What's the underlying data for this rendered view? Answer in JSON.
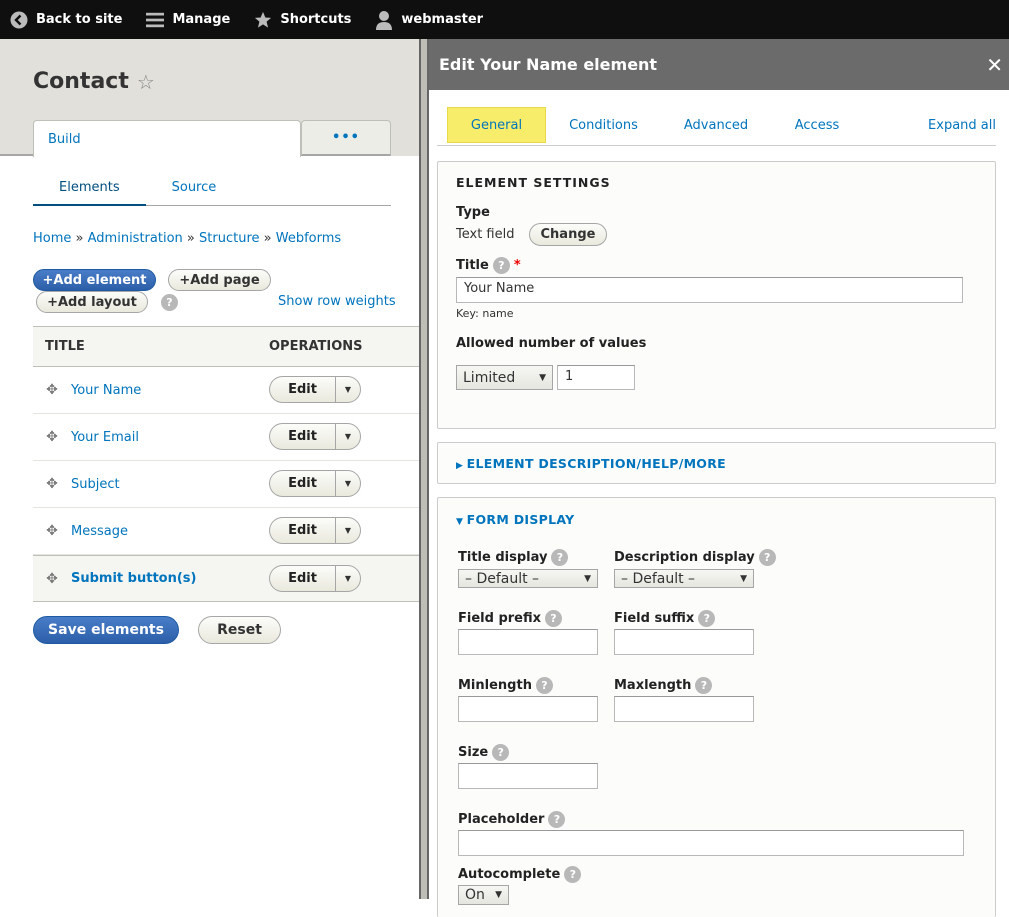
{
  "toolbar": {
    "back_to_site": "Back to site",
    "manage": "Manage",
    "shortcuts": "Shortcuts",
    "user": "webmaster"
  },
  "page": {
    "title": "Contact",
    "primary_tabs": [
      {
        "label": "Build",
        "active": true
      },
      {
        "label": "•••",
        "active": false
      }
    ],
    "secondary_tabs": [
      {
        "label": "Elements",
        "active": true
      },
      {
        "label": "Source",
        "active": false
      }
    ],
    "breadcrumb": [
      {
        "label": "Home"
      },
      {
        "label": "Administration"
      },
      {
        "label": "Structure"
      },
      {
        "label": "Webforms"
      }
    ],
    "breadcrumb_separator": "»",
    "actions": {
      "add_element": "+Add element",
      "add_page": "+Add page",
      "add_layout": "+Add layout",
      "show_row_weights": "Show row weights"
    },
    "table": {
      "headers": {
        "title": "TITLE",
        "operations": "OPERATIONS"
      },
      "rows": [
        {
          "title": "Your Name",
          "op": "Edit"
        },
        {
          "title": "Your Email",
          "op": "Edit"
        },
        {
          "title": "Subject",
          "op": "Edit"
        },
        {
          "title": "Message",
          "op": "Edit"
        },
        {
          "title": "Submit button(s)",
          "op": "Edit"
        }
      ]
    },
    "save_label": "Save elements",
    "reset_label": "Reset"
  },
  "dialog": {
    "title": "Edit Your Name element",
    "close_icon": "✕",
    "tabs": [
      {
        "label": "General",
        "active": true
      },
      {
        "label": "Conditions",
        "active": false
      },
      {
        "label": "Advanced",
        "active": false
      },
      {
        "label": "Access",
        "active": false
      }
    ],
    "expand_all": "Expand all",
    "element_settings": {
      "legend": "ELEMENT SETTINGS",
      "type_label": "Type",
      "type_value": "Text field",
      "change_label": "Change",
      "title_label": "Title",
      "required_marker": "*",
      "title_value": "Your Name",
      "key_text": "Key: name",
      "allowed_label": "Allowed number of values",
      "allowed_select": "Limited",
      "allowed_value": "1"
    },
    "description_section": {
      "legend": "ELEMENT DESCRIPTION/HELP/MORE",
      "expanded": false
    },
    "form_display": {
      "legend": "FORM DISPLAY",
      "expanded": true,
      "title_display_label": "Title display",
      "title_display_value": "– Default –",
      "description_display_label": "Description display",
      "description_display_value": "– Default –",
      "field_prefix_label": "Field prefix",
      "field_prefix_value": "",
      "field_suffix_label": "Field suffix",
      "field_suffix_value": "",
      "minlength_label": "Minlength",
      "minlength_value": "",
      "maxlength_label": "Maxlength",
      "maxlength_value": "",
      "size_label": "Size",
      "size_value": "",
      "placeholder_label": "Placeholder",
      "placeholder_value": "",
      "autocomplete_label": "Autocomplete",
      "autocomplete_value": "On"
    }
  },
  "colors": {
    "toolbar_bg": "#0f0f0f",
    "link": "#0074bd",
    "primary_button": "#3a6cb8",
    "active_tab_highlight": "#f7ed6a",
    "dialog_titlebar": "#6b6b6b",
    "required": "#e00000"
  }
}
